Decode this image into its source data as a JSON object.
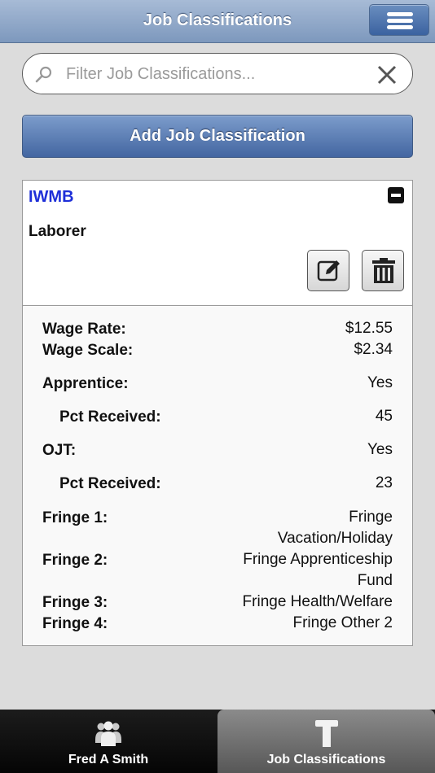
{
  "header": {
    "title": "Job Classifications",
    "menu_icon": "hamburger-menu-icon"
  },
  "search": {
    "placeholder": "Filter Job Classifications...",
    "value": "",
    "icon": "search-icon",
    "clear_icon": "close-icon"
  },
  "add_button": {
    "label": "Add Job Classification"
  },
  "card": {
    "code": "IWMB",
    "name": "Laborer",
    "collapse_icon": "minus-icon",
    "edit_icon": "edit-icon",
    "delete_icon": "trash-icon",
    "details": {
      "wage_rate": {
        "label": "Wage Rate:",
        "value": "$12.55"
      },
      "wage_scale": {
        "label": "Wage Scale:",
        "value": "$2.34"
      },
      "apprentice": {
        "label": "Apprentice:",
        "value": "Yes"
      },
      "apprentice_pct": {
        "label": "Pct Received:",
        "value": "45"
      },
      "ojt": {
        "label": "OJT:",
        "value": "Yes"
      },
      "ojt_pct": {
        "label": "Pct Received:",
        "value": "23"
      },
      "fringe1": {
        "label": "Fringe 1:",
        "value_line1": "Fringe",
        "value_line2": "Vacation/Holiday"
      },
      "fringe2": {
        "label": "Fringe 2:",
        "value_line1": "Fringe Apprenticeship",
        "value_line2": "Fund"
      },
      "fringe3": {
        "label": "Fringe 3:",
        "value": "Fringe Health/Welfare"
      },
      "fringe4": {
        "label": "Fringe 4:",
        "value": "Fringe Other 2"
      }
    }
  },
  "tabbar": {
    "tabs": [
      {
        "label": "Fred A Smith",
        "icon": "users-icon",
        "active": false
      },
      {
        "label": "Job Classifications",
        "icon": "signpost-icon",
        "active": true
      }
    ]
  },
  "colors": {
    "header": "#8fa7c9",
    "accent": "#1e2fd8",
    "button": "#4a6ca6"
  }
}
